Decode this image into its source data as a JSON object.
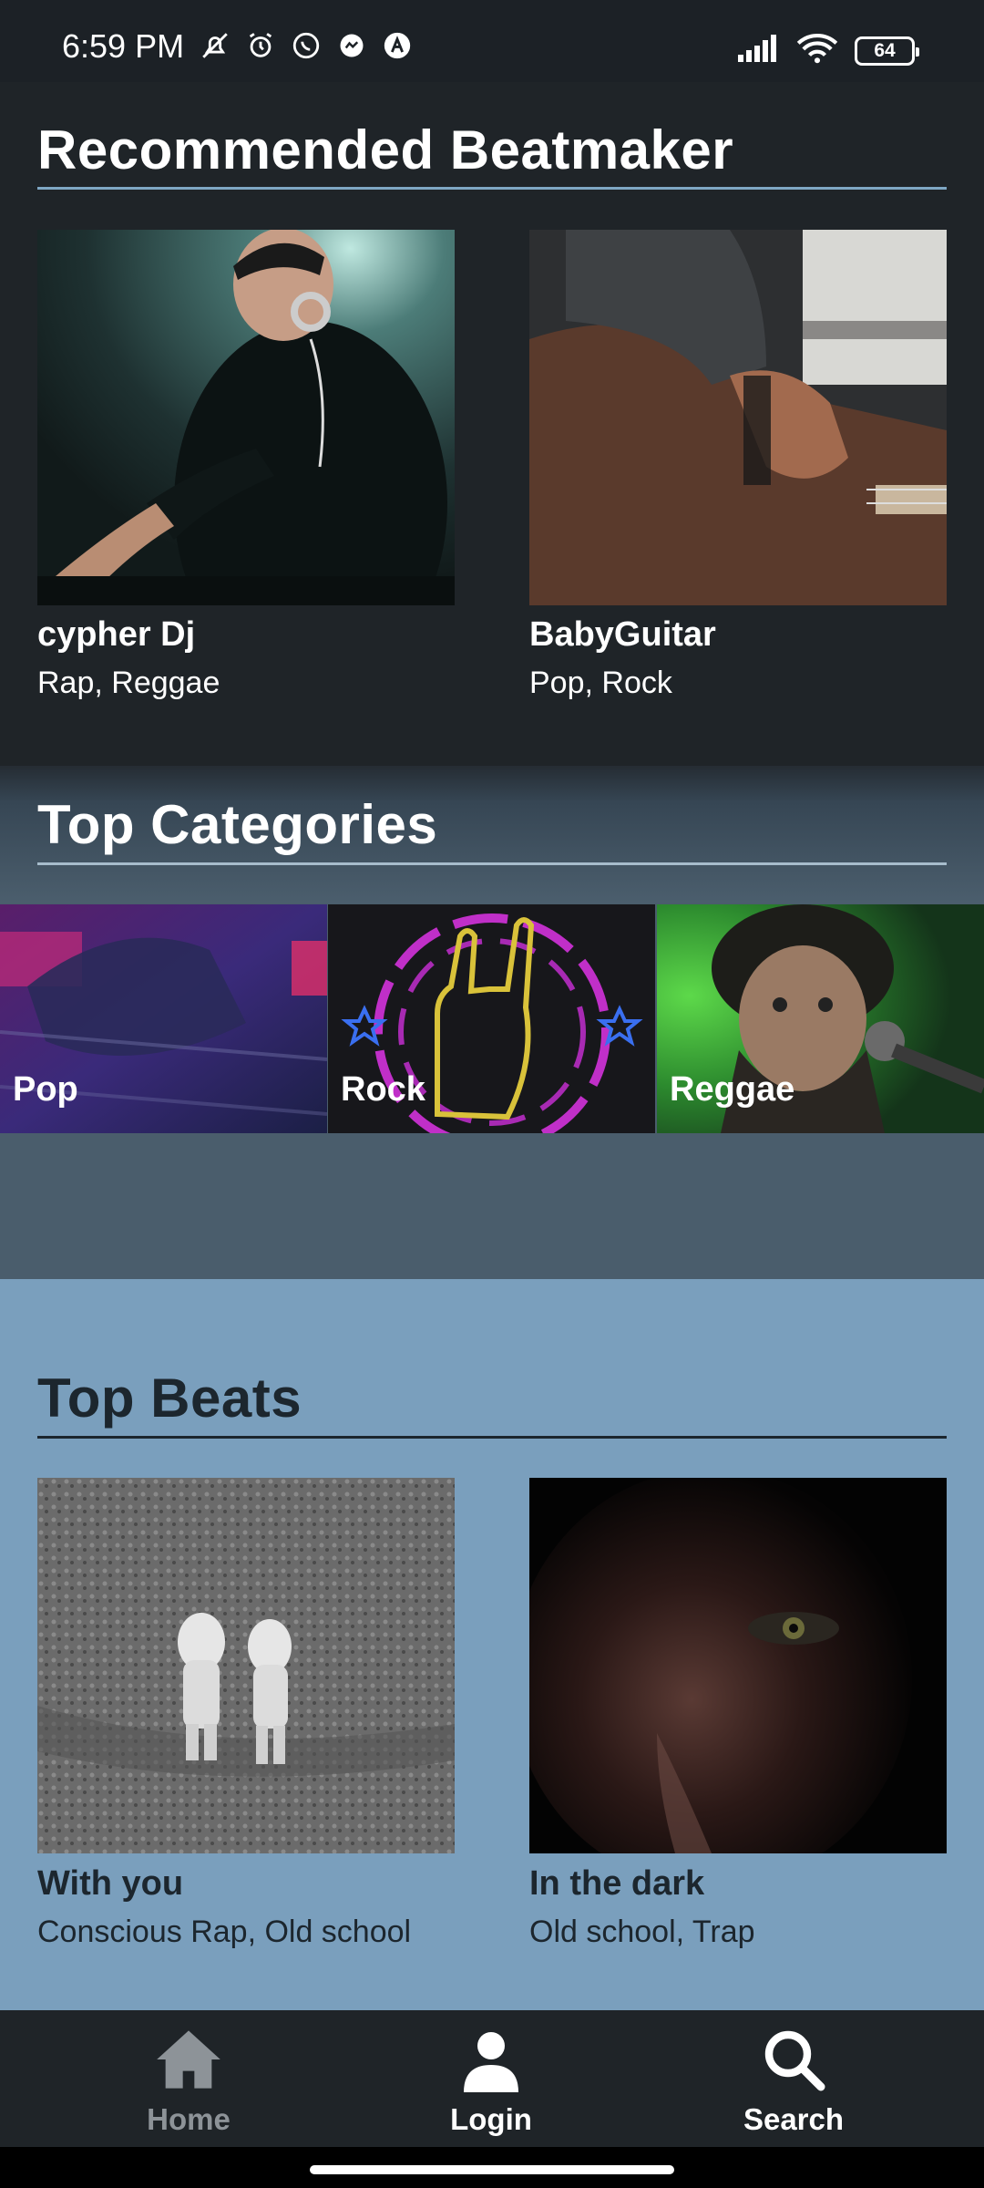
{
  "status_bar": {
    "time": "6:59 PM",
    "battery": "64",
    "icons_left": [
      "mute-icon",
      "alarm-icon",
      "whatsapp-icon",
      "messenger-icon",
      "app-icon"
    ],
    "icons_right": [
      "signal-icon",
      "wifi-icon",
      "battery-icon"
    ]
  },
  "recommended": {
    "title": "Recommended Beatmaker",
    "items": [
      {
        "name": "cypher Dj",
        "genres": "Rap, Reggae"
      },
      {
        "name": "BabyGuitar",
        "genres": "Pop, Rock"
      }
    ]
  },
  "categories": {
    "title": "Top Categories",
    "items": [
      {
        "label": "Pop"
      },
      {
        "label": "Rock"
      },
      {
        "label": "Reggae"
      }
    ]
  },
  "beats": {
    "title": "Top Beats",
    "items": [
      {
        "name": "With you",
        "genres": "Conscious Rap, Old school"
      },
      {
        "name": "In the dark",
        "genres": "Old school, Trap"
      }
    ]
  },
  "nav": {
    "items": [
      {
        "label": "Home",
        "icon": "home-icon",
        "active": false
      },
      {
        "label": "Login",
        "icon": "user-icon",
        "active": true
      },
      {
        "label": "Search",
        "icon": "search-icon",
        "active": true
      }
    ]
  },
  "colors": {
    "dark_bg": "#1f2428",
    "categories_bg": "#4a5d6c",
    "beats_bg": "#7a9fbd",
    "rule_light": "#7fa7c4",
    "text_dark": "#1c262e"
  }
}
